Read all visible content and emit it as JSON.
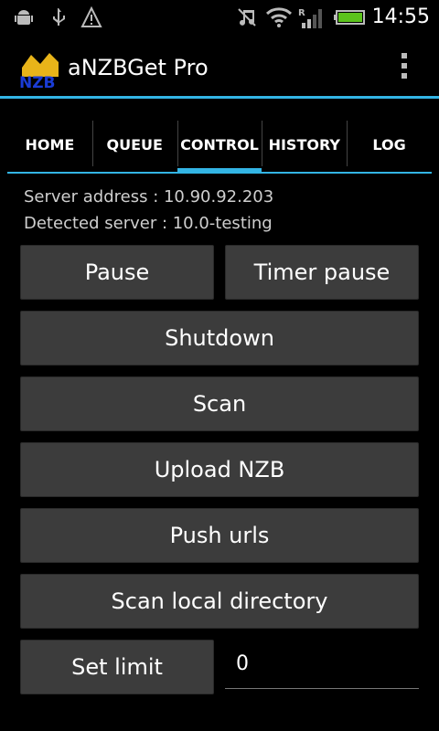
{
  "status_bar": {
    "icons": [
      "android-debug-icon",
      "usb-icon",
      "warning-icon",
      "mute-icon",
      "wifi-icon",
      "signal-icon",
      "battery-icon"
    ],
    "time": "14:55",
    "accent_color": "#33b5e5"
  },
  "action_bar": {
    "title": "aNZBGet Pro",
    "logo_text": "NZB"
  },
  "tabs": [
    {
      "label": "HOME"
    },
    {
      "label": "QUEUE"
    },
    {
      "label": "CONTROL",
      "active": true
    },
    {
      "label": "HISTORY"
    },
    {
      "label": "LOG"
    }
  ],
  "info": {
    "server_address": "Server address : 10.90.92.203",
    "detected_server": "Detected server : 10.0-testing"
  },
  "buttons": {
    "pause": "Pause",
    "timer_pause": "Timer pause",
    "shutdown": "Shutdown",
    "scan": "Scan",
    "upload_nzb": "Upload NZB",
    "push_urls": "Push urls",
    "scan_local_directory": "Scan local directory",
    "set_limit": "Set limit"
  },
  "limit_field": {
    "value": "0"
  }
}
